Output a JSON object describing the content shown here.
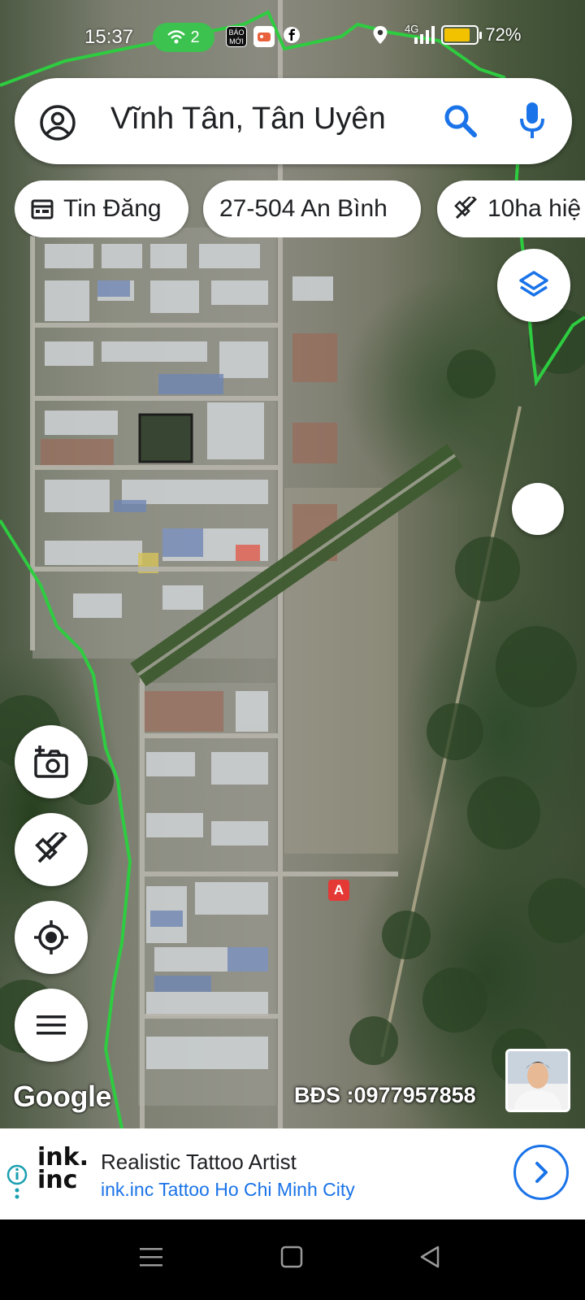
{
  "status_bar": {
    "time": "15:37",
    "wifi_count": "2",
    "app_icon_text": "BÁO MỚI",
    "network": "4G",
    "battery": "72%",
    "battery_level": 0.72
  },
  "search": {
    "query": "Vĩnh Tân, Tân Uyên"
  },
  "chips": [
    {
      "label": "Tin Đăng",
      "icon": "calendar-icon"
    },
    {
      "label": "27-504 An Bình",
      "icon": "none"
    },
    {
      "label": "10ha hiệ",
      "icon": "measure-icon"
    }
  ],
  "map": {
    "watermark": "Google",
    "overlay_text": "BĐS :0977957858",
    "marker_label": "A"
  },
  "ad": {
    "logo": "ink.\ninc",
    "title": "Realistic Tattoo Artist",
    "subtitle": "ink.inc Tattoo Ho Chi Minh City"
  },
  "colors": {
    "accent_blue": "#1a73e8",
    "boundary_green": "#2ecc40",
    "marker_red": "#e53935",
    "wifi_green": "#3cc24f"
  }
}
